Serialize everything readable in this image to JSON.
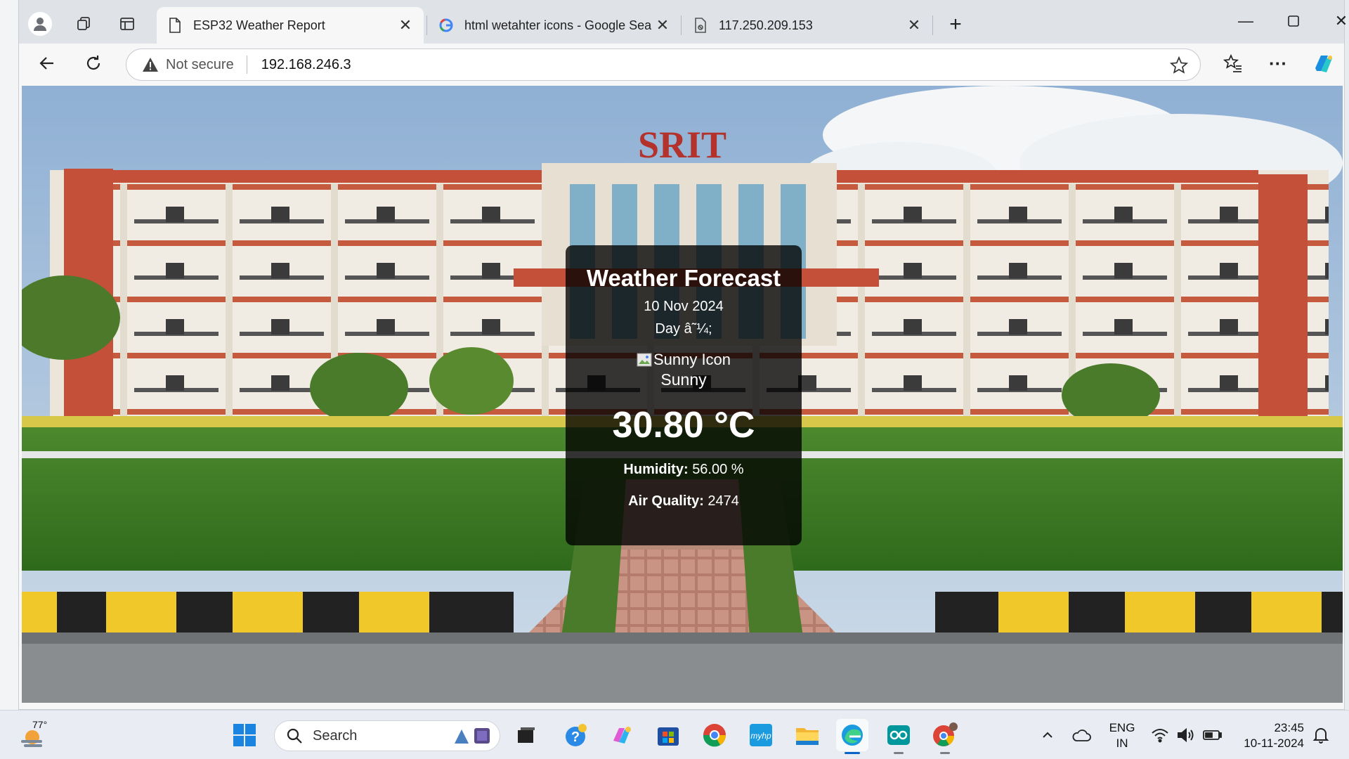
{
  "tabs": [
    {
      "title": "ESP32 Weather Report",
      "active": true
    },
    {
      "title": "html wetahter icons - Google Sea",
      "active": false
    },
    {
      "title": "117.250.209.153",
      "active": false
    }
  ],
  "address_bar": {
    "security_label": "Not secure",
    "url": "192.168.246.3"
  },
  "page": {
    "background_sign": "SRIT",
    "card": {
      "heading": "Weather Forecast",
      "date": "10 Nov 2024",
      "day": "Day â˜¼;",
      "icon_alt": "Sunny Icon",
      "condition": "Sunny",
      "temperature": "30.80 °C",
      "humidity_label": "Humidity:",
      "humidity_value": "56.00 %",
      "air_quality_label": "Air Quality:",
      "air_quality_value": "2474"
    }
  },
  "taskbar": {
    "weather_temp": "77°",
    "search_placeholder": "Search",
    "language_top": "ENG",
    "language_bottom": "IN",
    "time": "23:45",
    "date": "10-11-2024"
  },
  "colors": {
    "card_bg": "rgba(0,0,0,0.78)",
    "brand_red": "#c43a2e"
  }
}
